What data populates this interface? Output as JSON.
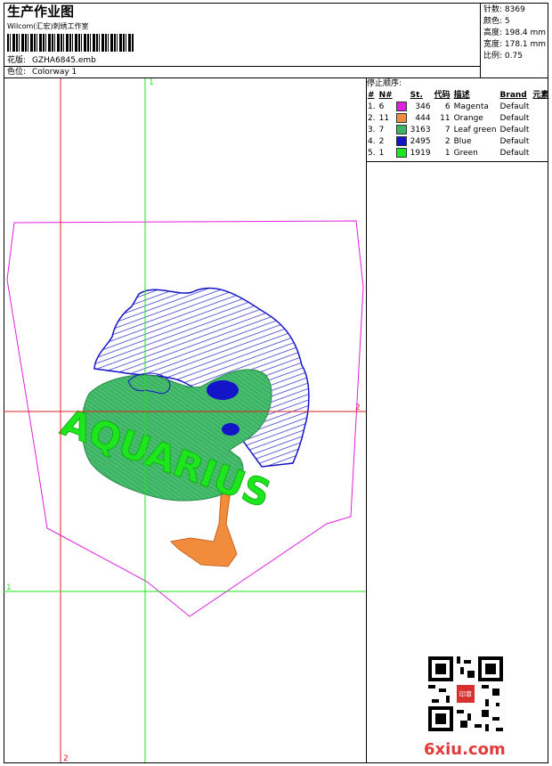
{
  "header": {
    "title": "生产作业图",
    "subtitle": "Wilcom(汇宏)刺绣工作室",
    "design_label": "花版:",
    "design_value": "GZHA6845.emb",
    "colorway_label": "色位:",
    "colorway_value": "Colorway 1"
  },
  "stats": {
    "stitches": "针数: 8369",
    "colors": "颜色: 5",
    "height": "高度: 198.4 mm",
    "width": "宽度: 178.1 mm",
    "ratio": "比例: 0.75"
  },
  "stop_sequence": {
    "label": "停止顺序:",
    "headers": [
      "#",
      "N#",
      "St.",
      "代码",
      "描述",
      "Brand",
      "元素"
    ],
    "rows": [
      {
        "idx": "1.",
        "n": "6",
        "color": "#e01fe0",
        "st": "346",
        "code": "6",
        "desc": "Magenta",
        "brand": "Default"
      },
      {
        "idx": "2.",
        "n": "11",
        "color": "#f08c3c",
        "st": "444",
        "code": "11",
        "desc": "Orange",
        "brand": "Default"
      },
      {
        "idx": "3.",
        "n": "7",
        "color": "#3cb464",
        "st": "3163",
        "code": "7",
        "desc": "Leaf green",
        "brand": "Default"
      },
      {
        "idx": "4.",
        "n": "2",
        "color": "#1414c8",
        "st": "2495",
        "code": "2",
        "desc": "Blue",
        "brand": "Default"
      },
      {
        "idx": "5.",
        "n": "1",
        "color": "#1ee61e",
        "st": "1919",
        "code": "1",
        "desc": "Green",
        "brand": "Default"
      }
    ]
  },
  "guides": {
    "v1_label": "1",
    "v2_label": "2",
    "h1_label": "1",
    "h2_label": "2"
  },
  "embroidery_text": "AQUARIUS",
  "watermark": "6xiu.com",
  "seal_text": "印章"
}
